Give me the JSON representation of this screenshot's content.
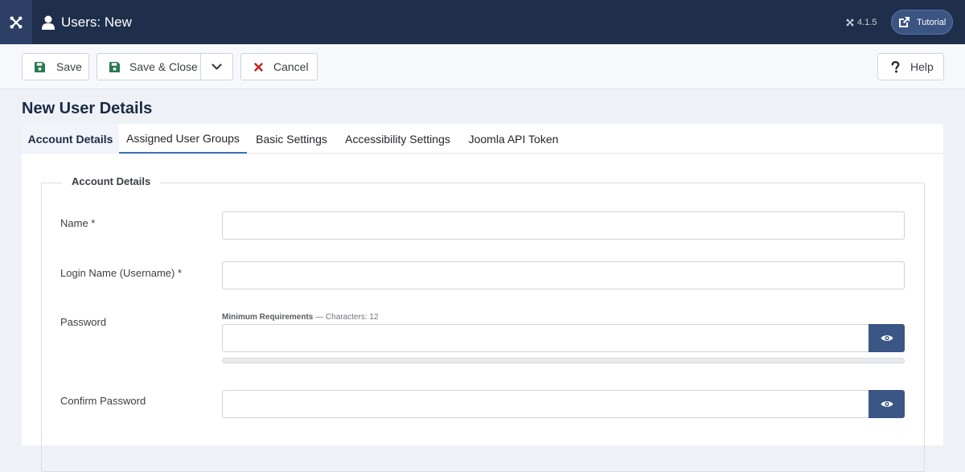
{
  "header": {
    "title": "Users: New",
    "version": "4.1.5",
    "tutorial_label": "Tutorial"
  },
  "toolbar": {
    "save_label": "Save",
    "save_close_label": "Save & Close",
    "cancel_label": "Cancel",
    "help_label": "Help"
  },
  "page": {
    "title": "New User Details"
  },
  "tabs": [
    {
      "label": "Account Details"
    },
    {
      "label": "Assigned User Groups"
    },
    {
      "label": "Basic Settings"
    },
    {
      "label": "Accessibility Settings"
    },
    {
      "label": "Joomla API Token"
    }
  ],
  "form": {
    "legend": "Account Details",
    "name_label": "Name *",
    "name_value": "",
    "username_label": "Login Name (Username) *",
    "username_value": "",
    "password_label": "Password",
    "password_req_title": "Minimum Requirements",
    "password_req_detail": "— Characters: 12",
    "password_value": "",
    "password_strength": 0,
    "confirm_label": "Confirm Password",
    "confirm_value": ""
  },
  "colors": {
    "header_bg": "#1f2e4a",
    "accent": "#3a5685",
    "cancel_red": "#c0271e",
    "tab_underline": "#3b6db8"
  }
}
